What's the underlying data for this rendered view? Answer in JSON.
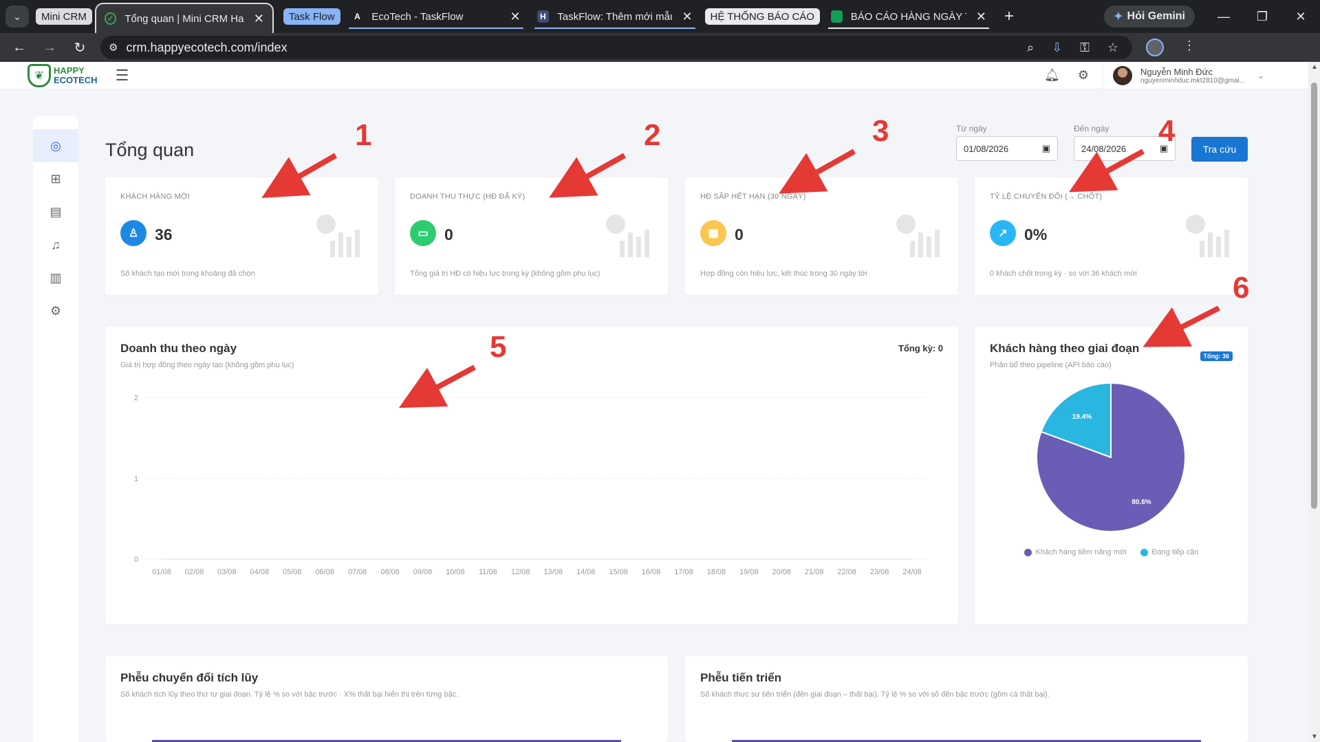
{
  "browser": {
    "group_chips": [
      "Mini CRM",
      "Task Flow",
      "HỆ THỐNG BÁO CÁO"
    ],
    "tabs": [
      {
        "title": "Tổng quan | Mini CRM Hap",
        "favicon": "crm-icon"
      },
      {
        "title": "EcoTech - TaskFlow",
        "favicon": "A"
      },
      {
        "title": "TaskFlow: Thêm mới mẫu c",
        "favicon": "H"
      },
      {
        "title": "BÁO CÁO HÀNG NGÀY TE",
        "favicon": "sheets-icon"
      }
    ],
    "gemini_label": "Hỏi Gemini",
    "url": "crm.happyecotech.com/index"
  },
  "app": {
    "logo_line1": "HAPPY",
    "logo_line2": "ECOTECH",
    "user_name": "Nguyễn Minh Đức",
    "user_email": "nguyenminhduc.mkt2810@gmai...",
    "page_title": "Tổng quan",
    "from_label": "Từ ngày",
    "from_value": "01/08/2026",
    "to_label": "Đến ngày",
    "to_value": "24/08/2026",
    "search_button": "Tra cứu"
  },
  "sidebar": {
    "items": [
      "dashboard-icon",
      "apps-icon",
      "document-icon",
      "bell-icon",
      "chart-icon",
      "settings-icon"
    ]
  },
  "kpis": [
    {
      "label": "KHÁCH HÀNG MỚI",
      "value": "36",
      "note": "Số khách tạo mới trong khoảng đã chọn",
      "color": "#1e88e5",
      "icon": "user-plus-icon"
    },
    {
      "label": "DOANH THU THỰC (HĐ ĐÃ KÝ)",
      "value": "0",
      "note": "Tổng giá trị HĐ có hiệu lực trong kỳ (không gồm phụ lục)",
      "color": "#2ecc71",
      "icon": "money-icon"
    },
    {
      "label": "HĐ SẮP HẾT HẠN (30 NGÀY)",
      "value": "0",
      "note": "Hợp đồng còn hiệu lực, kết thúc trong 30 ngày tới",
      "color": "#f9c74f",
      "icon": "calendar-icon"
    },
    {
      "label": "TỶ LỆ CHUYỂN ĐỔI (→ CHỐT)",
      "value": "0%",
      "note": "0 khách chốt trong kỳ · so với 36 khách mới",
      "color": "#29b6f6",
      "icon": "trend-icon"
    }
  ],
  "revenue_chart": {
    "title": "Doanh thu theo ngày",
    "subtitle": "Giá trị hợp đồng theo ngày tạo (không gồm phụ lục)",
    "total": "Tổng kỳ: 0"
  },
  "stage_chart": {
    "title": "Khách hàng theo giai đoạn",
    "subtitle": "Phân bổ theo pipeline (API báo cáo)",
    "badge": "Tổng: 36"
  },
  "funnel_cumulative": {
    "title": "Phễu chuyển đổi tích lũy",
    "subtitle": "Số khách tích lũy theo thứ tự giai đoạn. Tỷ lệ % so với bậc trước · X% thất bại hiển thị trên từng bậc."
  },
  "funnel_progress": {
    "title": "Phễu tiến triển",
    "subtitle": "Số khách thực sự tiến triển (đến giai đoạn – thất bại). Tỷ lệ % so với số đến bậc trước (gồm cả thất bại)."
  },
  "annotations": [
    "1",
    "2",
    "3",
    "4",
    "5",
    "6"
  ],
  "chart_data": [
    {
      "type": "line",
      "x": [
        "01/08",
        "02/08",
        "03/08",
        "04/08",
        "05/08",
        "06/08",
        "07/08",
        "08/08",
        "09/08",
        "10/08",
        "11/08",
        "12/08",
        "13/08",
        "14/08",
        "15/08",
        "16/08",
        "17/08",
        "18/08",
        "19/08",
        "20/08",
        "21/08",
        "22/08",
        "23/08",
        "24/08"
      ],
      "series": [
        {
          "values": [
            0,
            0,
            0,
            0,
            0,
            0,
            0,
            0,
            0,
            0,
            0,
            0,
            0,
            0,
            0,
            0,
            0,
            0,
            0,
            0,
            0,
            0,
            0,
            0
          ]
        }
      ],
      "ylim": [
        0,
        2
      ],
      "yticks": [
        0,
        1,
        2
      ],
      "grid": true
    },
    {
      "type": "pie",
      "slices": [
        {
          "name": "Khách hàng tiềm năng mới",
          "value": 80.6,
          "label": "80.6%",
          "color": "#6a5db5"
        },
        {
          "name": "Đang tiếp cận",
          "value": 19.4,
          "label": "19.4%",
          "color": "#29b6e0"
        }
      ],
      "legend": "bottom"
    }
  ]
}
